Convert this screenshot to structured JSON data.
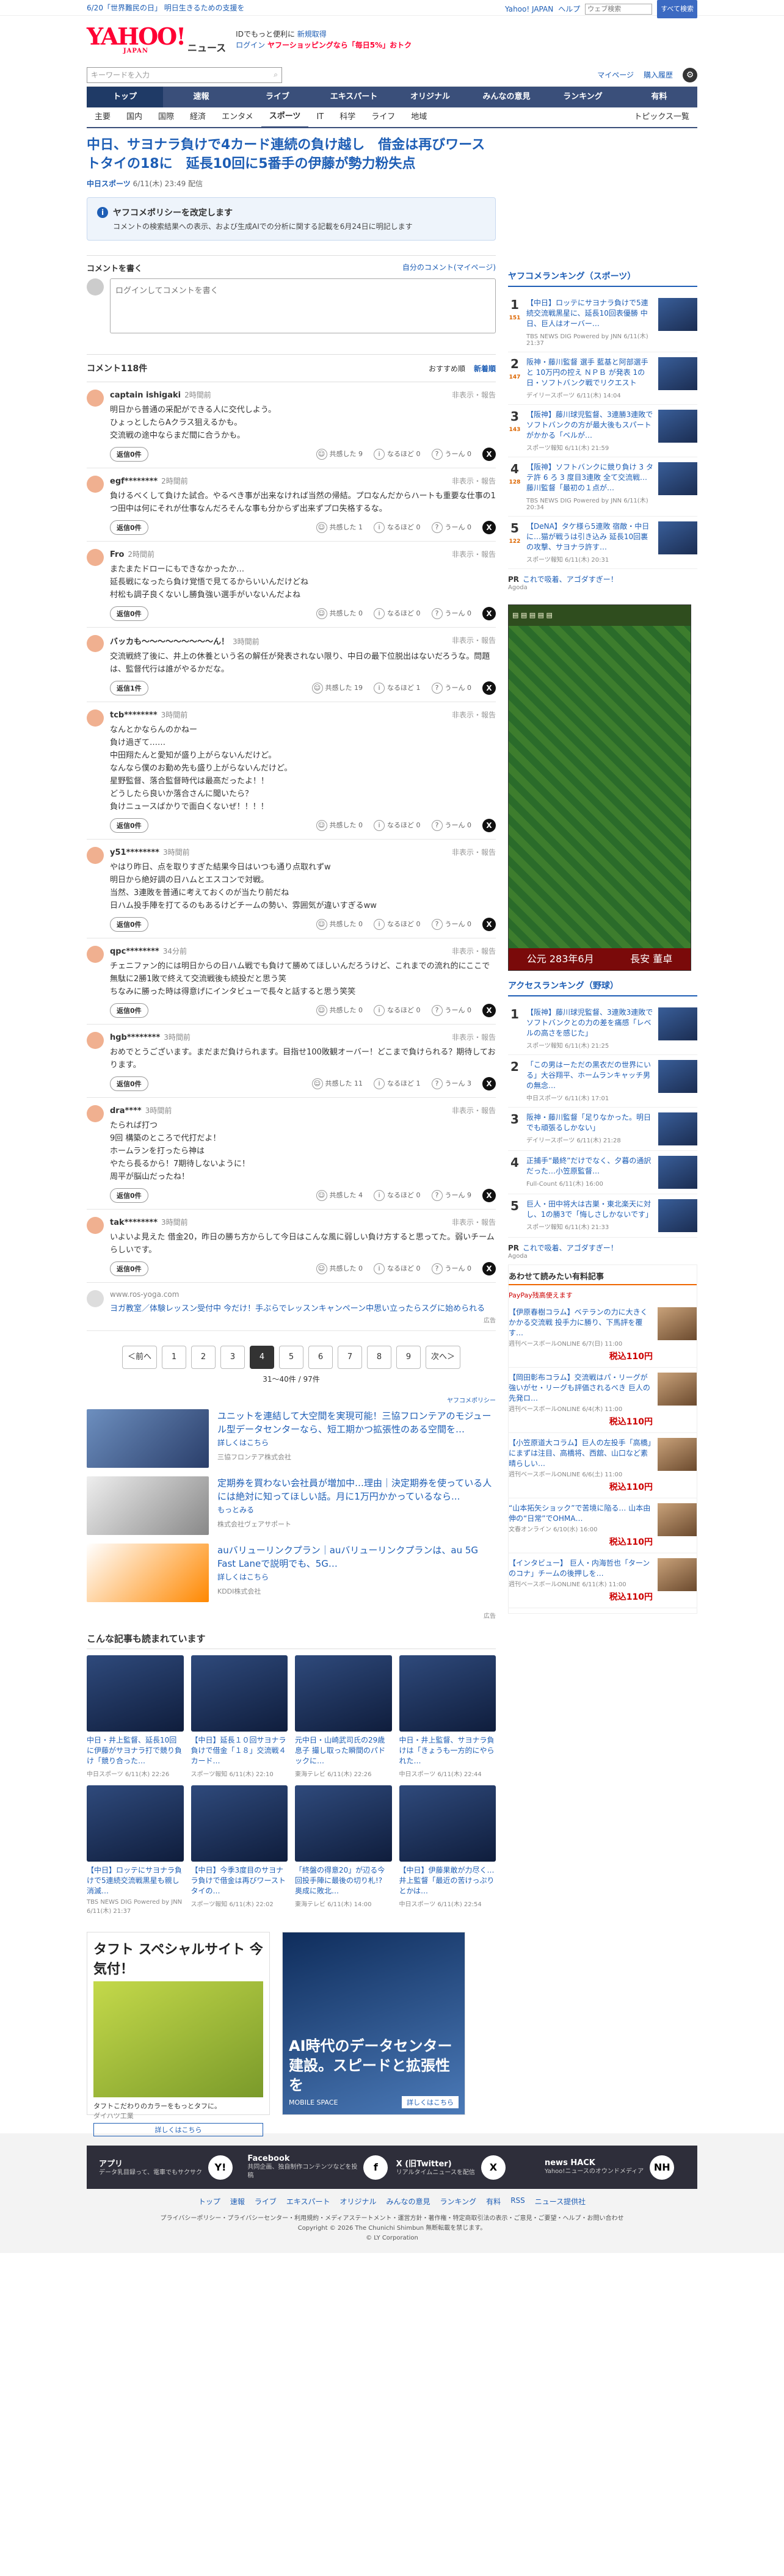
{
  "topbar": {
    "notice": "6/20「世界難民の日」 明日生きるための支援を",
    "links": [
      "Yahoo! JAPAN",
      "ヘルプ"
    ],
    "search_placeholder": "ウェブ検索",
    "search_btn": "すべて検索"
  },
  "header": {
    "logo": "YAHOO!",
    "logo_sub": "JAPAN",
    "section": "ニュース",
    "tag1": "IDでもっと便利に",
    "tag1b": "新規取得",
    "tag2": "ログイン",
    "tag2b": "ヤフーショッピングなら「毎日5%」おトク"
  },
  "search": {
    "placeholder": "キーワードを入力",
    "mypage": "マイページ",
    "buy": "購入履歴"
  },
  "gnav": [
    "トップ",
    "速報",
    "ライブ",
    "エキスパート",
    "オリジナル",
    "みんなの意見",
    "ランキング",
    "有料"
  ],
  "snav": [
    "主要",
    "国内",
    "国際",
    "経済",
    "エンタメ",
    "スポーツ",
    "IT",
    "科学",
    "ライフ",
    "地域"
  ],
  "snav_right": "トピックス一覧",
  "article": {
    "title": "中日、サヨナラ負けで4カード連続の負け越し　借金は再びワーストタイの18に　延長10回に5番手の伊藤が勢力粉失点",
    "source": "中日スポーツ",
    "time": "6/11(木) 23:49 配信"
  },
  "policy": {
    "title": "ヤフコメポリシーを改定します",
    "desc": "コメントの検索結果への表示、および生成AIでの分析に関する記載を6月24日に明記します"
  },
  "write": {
    "title": "コメントを書く",
    "link": "自分のコメント(マイページ)",
    "placeholder": "ログインしてコメントを書く"
  },
  "comments_head": {
    "count": "コメント118件",
    "sort1": "おすすめ順",
    "sort2": "新着順"
  },
  "labels": {
    "reply_btn": "返信0件",
    "reply_btn1": "返信1件",
    "report": "非表示・報告",
    "react1": "共感した",
    "react2": "なるほど",
    "react3": "うーん"
  },
  "comments": [
    {
      "user": "captain ishigaki",
      "time": "2時間前",
      "text": "明日から普通の采配ができる人に交代しよう。\nひょっとしたらAクラス狙えるかも。\n交流戦の途中ならまだ間に合うかも。",
      "r1": "9",
      "r2": "0",
      "r3": "0",
      "rep": "返信0件"
    },
    {
      "user": "egf********",
      "time": "2時間前",
      "text": "負けるべくして負けた試合。やるべき事が出来なければ当然の帰結。プロなんだからハートも重要な仕事の1つ田中は何にそれが仕事なんだろそんな事も分からず出来ずプロ失格するな。",
      "r1": "1",
      "r2": "0",
      "r3": "0",
      "rep": "返信0件"
    },
    {
      "user": "Fro",
      "time": "2時間前",
      "text": "またまたドローにもできなかったか…\n延長戦になったら負け覚悟で見てるからいいんだけどね\n村松も調子良くないし勝負強い選手がいないんだよね",
      "r1": "0",
      "r2": "0",
      "r3": "0",
      "rep": "返信0件"
    },
    {
      "user": "バッカも〜〜〜〜〜〜〜〜〜ん！",
      "time": "3時間前",
      "text": "交流戦終了後に、井上の休養という名の解任が発表されない限り、中日の最下位脱出はないだろうな。問題は、監督代行は誰がやるかだな。",
      "r1": "19",
      "r2": "1",
      "r3": "0",
      "rep": "返信1件"
    },
    {
      "user": "tcb********",
      "time": "3時間前",
      "text": "なんとかならんのかねー\n負け過ぎて……\n中田翔たんと愛知が盛り上がらないんだけど。\nなんなら僕のお勤め先も盛り上がらないんだけど。\n星野監督、落合監督時代は最高だったよ！！\nどうしたら良いか落合さんに聞いたら？\n負けニュースばかりで面白くないぜ！！！！",
      "r1": "0",
      "r2": "0",
      "r3": "0",
      "rep": "返信0件"
    },
    {
      "user": "y51********",
      "time": "3時間前",
      "text": "やはり昨日、点を取りすぎた結果今日はいつも通り点取れずw\n明日から絶好調の日ハムとエスコンで対戦。\n当然、3連敗を普通に考えておくのが当たり前だね\n日ハム投手陣を打てるのもあるけどチームの勢い、雰囲気が違いすぎるww",
      "r1": "0",
      "r2": "0",
      "r3": "0",
      "rep": "返信0件"
    },
    {
      "user": "qpc********",
      "time": "34分前",
      "text": "チェニファン的には明日からの日ハム戦でも負けて勝めてほしいんだろうけど、これまでの流れ的にここで無駄に2勝1敗で終えて交流戦後も続投だと思う笑\nちなみに勝った時は得意げにインタビューで長々と話すると思う笑笑",
      "r1": "0",
      "r2": "0",
      "r3": "0",
      "rep": "返信0件"
    },
    {
      "user": "hgb********",
      "time": "3時間前",
      "text": "おめでとうございます。まだまだ負けられます。目指せ100敗観オーバー！どこまで負けられる？期待しております。",
      "r1": "11",
      "r2": "1",
      "r3": "3",
      "rep": "返信0件"
    },
    {
      "user": "dra****",
      "time": "3時間前",
      "text": "たられば打つ\n9回 構築のところで代打だよ！\nホームランを打ったら神は\nやたら長るから！7期待しないように！\n周平が脳山だったね！",
      "r1": "4",
      "r2": "0",
      "r3": "9",
      "rep": "返信0件"
    },
    {
      "user": "tak********",
      "time": "3時間前",
      "text": "いよいよ見えた 借金20，昨日の勝ち方からして今日はこんな風に弱しい負け方すると思ってた。弱いチームらしいです。",
      "r1": "0",
      "r2": "0",
      "r3": "0",
      "rep": "返信0件"
    }
  ],
  "comment_ad": {
    "src": "www.ros-yoga.com",
    "text": "ヨガ教室／体験レッスン受付中 今だけ！手ぶらでレッスンキャンペーン中思い立ったらスグに始められる",
    "mark": "広告"
  },
  "pagination": {
    "prev": "＜前へ",
    "pages": [
      "1",
      "2",
      "3",
      "4",
      "5",
      "6",
      "7",
      "8",
      "9"
    ],
    "current": "4",
    "next": "次へ＞",
    "count": "31〜40件 / 97件"
  },
  "ads_policy": "ヤフコメポリシー",
  "ad_list": [
    {
      "title": "ユニットを連結して大空間を実現可能！三協フロンテアのモジュール型データセンターなら、短工期かつ拡張性のある空間を…",
      "more": "詳しくはこちら",
      "src": "三協フロンテア株式会社"
    },
    {
      "title": "定期券を買わない会社員が増加中…理由｜決定期券を使っている人には絶対に知ってほしい話。月に1万円かかっているなら...",
      "more": "もっとみる",
      "src": "株式会社ヴェアサポート"
    },
    {
      "title": "auバリューリンクプラン｜auバリューリンクプランは、au 5G Fast Laneで説明でも、5G…",
      "more": "詳しくはこちら",
      "src": "KDDI株式会社"
    }
  ],
  "ad_mark": "広告",
  "also_read": {
    "title": "こんな記事も読まれています",
    "items": [
      {
        "t": "中日・井上監督、延長10回に伊藤がサヨナラ打で競り負け「競り合った…",
        "s": "中日スポーツ 6/11(木) 22:26"
      },
      {
        "t": "【中日】延長１０回サヨナラ負けで借金「１８」交流戦４カード…",
        "s": "スポーツ報知 6/11(木) 22:10"
      },
      {
        "t": "元中日・山崎武司氏の29歳息子 撮し取った瞬間のパドックに…",
        "s": "東海テレビ 6/11(木) 22:26"
      },
      {
        "t": "中日・井上監督、サヨナラ負けは「きょうも一方的にやられた…",
        "s": "中日スポーツ 6/11(木) 22:44"
      },
      {
        "t": "【中日】ロッテにサヨナラ負けで5連続交流戦黒星も親し消滅…",
        "s": "TBS NEWS DIG Powered by JNN 6/11(木) 21:37"
      },
      {
        "t": "【中日】今季3度目のサヨナラ負けで借金は再びワーストタイの…",
        "s": "スポーツ報知 6/11(木) 22:02"
      },
      {
        "t": "「終盤の得意20」が辺る今回投手陣に最後の切り札!? 奥成に敗北…",
        "s": "東海テレビ 6/11(木) 14:00"
      },
      {
        "t": "【中日】伊藤果敢が力尽く…井上監督「最近の苦けっぷりとかは…",
        "s": "中日スポーツ 6/11(木) 22:54"
      }
    ]
  },
  "bigad1": {
    "title": "タフト スペシャルサイト 今気付！",
    "brand": "TAFT",
    "src": "ダイハツ工業",
    "caption": "タフトこだわりのカラーをもっとタフに。",
    "more": "詳しくはこちら"
  },
  "bigad2": {
    "title": "AI時代のデータセンター建設。スピードと拡張性を",
    "brand": "MOBILE SPACE",
    "more": "詳しくはこちら"
  },
  "rank_sports": {
    "title": "ヤフコメランキング（スポーツ）",
    "items": [
      {
        "n": "1",
        "c": "151",
        "t": "【中日】ロッテにサヨナラ負けで5連続交流戦黒星に、延長10回表優勝 中日、巨人はオーバー…",
        "s": "TBS NEWS DIG Powered by JNN 6/11(木) 21:37"
      },
      {
        "n": "2",
        "c": "147",
        "t": "阪神・藤川監督 選手 藍基と阿部選手と 10万円の控え ＮＰＢ が発表 1の日・ソフトバンク戦でリクエスト",
        "s": "デイリースポーツ 6/11(木) 14:04"
      },
      {
        "n": "3",
        "c": "143",
        "t": "【阪神】藤川球児監督、3連勝3連敗でソフトバンクの方が最大後もスパートがかかる「ベルが…",
        "s": "スポーツ報知 6/11(木) 21:59"
      },
      {
        "n": "4",
        "c": "128",
        "t": "【阪神】ソフトバンクに競り負け 3 タテ許 6 ろ 3 度目3連敗 全て交流戦…藤川監督「最初の１点が…",
        "s": "TBS NEWS DIG Powered by JNN 6/11(木) 20:34"
      },
      {
        "n": "5",
        "c": "122",
        "t": "【DeNA】タケ様ら5連敗 宿敵・中日に…猫が戦うは引き込み 延長10回裏の攻撃、サヨナラ許す…",
        "s": "スポーツ報知 6/11(木) 20:31"
      }
    ]
  },
  "pr1": {
    "label": "PR",
    "text": "これで吸着、アゴダすぎー！",
    "src": "Agoda"
  },
  "game": {
    "era": "公元 283年6月",
    "place": "長安 董卓"
  },
  "rank_access": {
    "title": "アクセスランキング（野球）",
    "items": [
      {
        "n": "1",
        "t": "【阪神】藤川球児監督、3連敗3連敗でソフトバンクとの力の差を痛感「レベルの高さを感じた」",
        "s": "スポーツ報知 6/11(木) 21:25"
      },
      {
        "n": "2",
        "t": "「この男はーただの黒衣だの世界にいる」大谷翔平、ホームランキャッチ男の無念…",
        "s": "中日スポーツ 6/11(木) 17:01"
      },
      {
        "n": "3",
        "t": "阪神・藤川監督「足りなかった。明日でも頑張るしかない」",
        "s": "デイリースポーツ 6/11(木) 21:28"
      },
      {
        "n": "4",
        "t": "正捕手“最終”だけでなく、夕暮の通訳だった…小笠原監督…",
        "s": "Full-Count 6/11(木) 16:00"
      },
      {
        "n": "5",
        "t": "巨人・田中将大は古巣・東北楽天に対し、1の勝3で「悔しさしかないです」",
        "s": "スポーツ報知 6/11(木) 21:33"
      }
    ]
  },
  "pr2": {
    "label": "PR",
    "text": "これで吸着、アゴダすぎー！",
    "src": "Agoda"
  },
  "paid": {
    "title": "あわせて読みたい有料記事",
    "sub": "PayPay残高使えます",
    "items": [
      {
        "t": "【伊原春樹コラム】ベテランの力に大きくかかる交流戦 投手力に勝り、下馬評を覆す…",
        "s": "週刊ベースボールONLINE 6/7(日) 11:00",
        "p": "税込110円"
      },
      {
        "t": "【岡田彰布コラム】交流戦はパ・リーグが強いがセ・リーグも評価されるべき 巨人の先発ロ…",
        "s": "週刊ベースボールONLINE 6/4(木) 11:00",
        "p": "税込110円"
      },
      {
        "t": "【小笠原道大コラム】巨人の左投手「高橋」にまずは注目、高橋将、西舘、山口など素晴らしい…",
        "s": "週刊ベースボールONLINE 6/6(土) 11:00",
        "p": "税込110円"
      },
      {
        "t": "“山本拓矢ショック”で苦境に陥る… 山本由伸の“日常”でOHMA…",
        "s": "文春オンライン 6/10(水) 16:00",
        "p": "税込110円"
      },
      {
        "t": "【インタビュー】 巨人・内海哲也「ターンのコナ」チームの後押しを…",
        "s": "週刊ベースボールONLINE 6/11(木) 11:00",
        "p": "税込110円"
      }
    ]
  },
  "footer": {
    "apps": [
      {
        "t": "アプリ",
        "d": "データ乳目録って、電車でもサクサク",
        "lg": "Y!"
      },
      {
        "t": "Facebook",
        "d": "共同企画、独自制作コンテンツなどを投稿",
        "lg": "f"
      },
      {
        "t": "X (旧Twitter)",
        "d": "リアルタイムニュースを配信",
        "lg": "X"
      },
      {
        "t": "news HACK",
        "d": "Yahoo!ニュースのオウンドメディア",
        "lg": "NH"
      }
    ],
    "links": [
      "トップ",
      "速報",
      "ライブ",
      "エキスパート",
      "オリジナル",
      "みんなの意見",
      "ランキング",
      "有料",
      "RSS",
      "ニュース提供社"
    ],
    "legal": "プライバシーポリシー・プライバシーセンター・利用規約・メディアステートメント・運営方針・著作権・特定商取引法の表示・ご意見・ご要望・ヘルプ・お問い合わせ",
    "copy1": "Copyright © 2026 The Chunichi Shimbun 無断転載を禁じます。",
    "copy2": "© LY Corporation"
  }
}
